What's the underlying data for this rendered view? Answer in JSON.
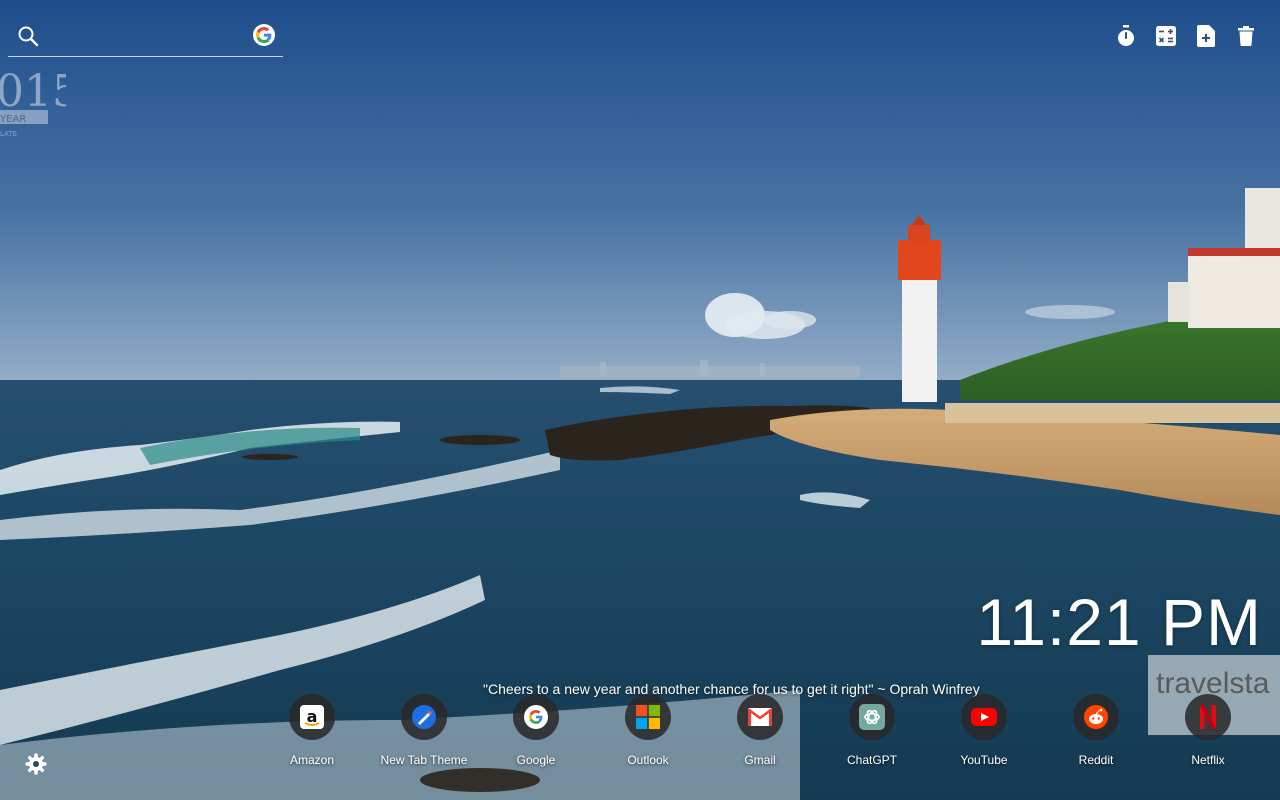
{
  "search": {
    "placeholder": "",
    "value": ""
  },
  "toolbar": {
    "items": [
      {
        "icon": "timer-icon"
      },
      {
        "icon": "calculator-icon"
      },
      {
        "icon": "new-note-icon"
      },
      {
        "icon": "trash-icon"
      }
    ]
  },
  "clock": {
    "time": "11:21 PM"
  },
  "quote": {
    "text": "\"Cheers to a new year and another chance for us to get it right\" ~ Oprah Winfrey"
  },
  "shortcuts": [
    {
      "label": "Amazon",
      "icon": "amazon-icon"
    },
    {
      "label": "New Tab Theme",
      "icon": "new-tab-theme-icon"
    },
    {
      "label": "Google",
      "icon": "google-icon"
    },
    {
      "label": "Outlook",
      "icon": "outlook-icon"
    },
    {
      "label": "Gmail",
      "icon": "gmail-icon"
    },
    {
      "label": "ChatGPT",
      "icon": "chatgpt-icon"
    },
    {
      "label": "YouTube",
      "icon": "youtube-icon"
    },
    {
      "label": "Reddit",
      "icon": "reddit-icon"
    },
    {
      "label": "Netflix",
      "icon": "netflix-icon"
    }
  ],
  "watermark": {
    "text": "travelsta"
  },
  "colors": {
    "sky_top": "#1f4e8c",
    "sky_horizon": "#8ea9c6",
    "sea": "#1d4a6a",
    "sand": "#c9a373",
    "lighthouse_red": "#e2461c",
    "google_blue": "#4285F4",
    "google_red": "#EA4335",
    "google_yellow": "#FBBC05",
    "google_green": "#34A853"
  }
}
